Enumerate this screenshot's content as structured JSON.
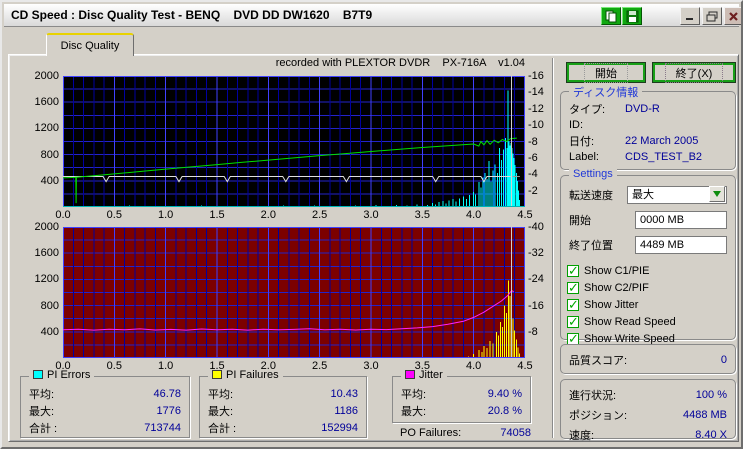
{
  "window": {
    "title": "CD Speed : Disc Quality Test - BENQ    DVD DD DW1620    B7T9"
  },
  "tab": {
    "label": "Disc Quality"
  },
  "chart_header": "recorded with PLEXTOR DVDR    PX-716A    v1.04",
  "chart_data": [
    {
      "type": "line+spikes",
      "title": "PI Errors / Read & Write Speed",
      "bg": "#000000",
      "border_bottom": "#00b6b6",
      "x_max": 4.5,
      "x_ticks": [
        "0.0",
        "0.5",
        "1.0",
        "1.5",
        "2.0",
        "2.5",
        "3.0",
        "3.5",
        "4.0",
        "4.5"
      ],
      "y_left": {
        "max": 2000,
        "ticks": [
          2000,
          1600,
          1200,
          800,
          400
        ]
      },
      "y_right": {
        "max": 16,
        "ticks": [
          16,
          14,
          12,
          10,
          8,
          6,
          4,
          2
        ]
      },
      "cursor_x": 4.37,
      "series": [
        {
          "name": "pi-errors",
          "type": "spikes",
          "color": "#00ffff",
          "points": [
            [
              0.05,
              14
            ],
            [
              0.15,
              8
            ],
            [
              0.25,
              18
            ],
            [
              0.35,
              6
            ],
            [
              0.45,
              16
            ],
            [
              0.55,
              9
            ],
            [
              0.65,
              20
            ],
            [
              0.75,
              7
            ],
            [
              0.85,
              14
            ],
            [
              0.95,
              10
            ],
            [
              1.05,
              18
            ],
            [
              1.15,
              8
            ],
            [
              1.25,
              15
            ],
            [
              1.35,
              22
            ],
            [
              1.45,
              9
            ],
            [
              1.55,
              16
            ],
            [
              1.65,
              7
            ],
            [
              1.75,
              19
            ],
            [
              1.85,
              11
            ],
            [
              1.95,
              15
            ],
            [
              2.05,
              8
            ],
            [
              2.15,
              20
            ],
            [
              2.25,
              10
            ],
            [
              2.35,
              16
            ],
            [
              2.45,
              24
            ],
            [
              2.55,
              12
            ],
            [
              2.65,
              18
            ],
            [
              2.75,
              9
            ],
            [
              2.85,
              22
            ],
            [
              2.95,
              14
            ],
            [
              3.05,
              28
            ],
            [
              3.15,
              18
            ],
            [
              3.25,
              32
            ],
            [
              3.35,
              22
            ],
            [
              3.45,
              38
            ],
            [
              3.55,
              30
            ],
            [
              3.6,
              60
            ],
            [
              3.63,
              40
            ],
            [
              3.66,
              75
            ],
            [
              3.7,
              90
            ],
            [
              3.73,
              55
            ],
            [
              3.76,
              100
            ],
            [
              3.8,
              120
            ],
            [
              3.83,
              85
            ],
            [
              3.86,
              130
            ],
            [
              3.9,
              160
            ],
            [
              3.93,
              120
            ],
            [
              3.96,
              180
            ],
            [
              4.0,
              230
            ],
            [
              4.02,
              190
            ],
            [
              4.05,
              380
            ],
            [
              4.07,
              300
            ],
            [
              4.09,
              450
            ],
            [
              4.11,
              520
            ],
            [
              4.13,
              430
            ],
            [
              4.15,
              700
            ],
            [
              4.17,
              390
            ],
            [
              4.19,
              560
            ],
            [
              4.21,
              650
            ],
            [
              4.23,
              520
            ],
            [
              4.25,
              900
            ],
            [
              4.27,
              720
            ],
            [
              4.29,
              880
            ],
            [
              4.31,
              1050
            ],
            [
              4.325,
              900
            ],
            [
              4.335,
              1776
            ],
            [
              4.345,
              1000
            ],
            [
              4.355,
              940
            ],
            [
              4.365,
              980
            ],
            [
              4.375,
              900
            ],
            [
              4.385,
              820
            ],
            [
              4.395,
              750
            ],
            [
              4.405,
              640
            ],
            [
              4.415,
              520
            ],
            [
              4.425,
              400
            ],
            [
              4.435,
              250
            ],
            [
              4.445,
              110
            ]
          ]
        },
        {
          "name": "write-speed",
          "type": "line",
          "color": "#dedede",
          "points": [
            [
              0,
              465
            ],
            [
              0.39,
              465
            ],
            [
              0.42,
              388
            ],
            [
              0.45,
              465
            ],
            [
              1.1,
              465
            ],
            [
              1.13,
              388
            ],
            [
              1.16,
              465
            ],
            [
              1.57,
              465
            ],
            [
              1.6,
              388
            ],
            [
              1.63,
              465
            ],
            [
              2.14,
              465
            ],
            [
              2.17,
              388
            ],
            [
              2.2,
              465
            ],
            [
              2.73,
              465
            ],
            [
              2.76,
              388
            ],
            [
              2.79,
              465
            ],
            [
              3.6,
              465
            ],
            [
              3.63,
              388
            ],
            [
              3.66,
              465
            ],
            [
              4.07,
              465
            ],
            [
              4.1,
              388
            ],
            [
              4.13,
              465
            ],
            [
              4.36,
              465
            ]
          ]
        },
        {
          "name": "write-speed-tail",
          "type": "line",
          "color": "#9a9a9a",
          "points": [
            [
              4.38,
              465
            ],
            [
              4.45,
              465
            ]
          ]
        },
        {
          "name": "read-speed",
          "type": "line",
          "color": "#00e000",
          "points": [
            [
              0,
              445
            ],
            [
              0.11,
              452
            ],
            [
              0.125,
              455
            ],
            [
              0.128,
              60
            ],
            [
              0.131,
              455
            ],
            [
              0.3,
              478
            ],
            [
              0.5,
              505
            ],
            [
              0.75,
              542
            ],
            [
              1.0,
              578
            ],
            [
              1.25,
              612
            ],
            [
              1.5,
              648
            ],
            [
              1.75,
              682
            ],
            [
              2.0,
              716
            ],
            [
              2.25,
              750
            ],
            [
              2.5,
              784
            ],
            [
              2.75,
              816
            ],
            [
              3.0,
              848
            ],
            [
              3.25,
              878
            ],
            [
              3.5,
              908
            ],
            [
              3.75,
              936
            ],
            [
              4.0,
              962
            ],
            [
              4.05,
              930
            ],
            [
              4.07,
              1000
            ],
            [
              4.1,
              950
            ],
            [
              4.13,
              1012
            ],
            [
              4.16,
              958
            ],
            [
              4.2,
              1018
            ],
            [
              4.24,
              980
            ],
            [
              4.28,
              1030
            ],
            [
              4.32,
              1000
            ],
            [
              4.36,
              1045
            ],
            [
              4.42,
              1052
            ]
          ]
        }
      ]
    },
    {
      "type": "line+spikes",
      "title": "PI Failures / Jitter",
      "bg": "#7c0000",
      "border_bottom": "#4040ff",
      "x_max": 4.5,
      "x_ticks": [
        "0.0",
        "0.5",
        "1.0",
        "1.5",
        "2.0",
        "2.5",
        "3.0",
        "3.5",
        "4.0",
        "4.5"
      ],
      "y_left": {
        "max": 2000,
        "ticks": [
          2000,
          1600,
          1200,
          800,
          400
        ]
      },
      "y_right": {
        "max": 40,
        "ticks": [
          40,
          32,
          24,
          16,
          8
        ]
      },
      "cursor_x": 4.37,
      "series": [
        {
          "name": "pi-failures",
          "type": "spikes",
          "color": "#ffff00",
          "points": [
            [
              0.3,
              10
            ],
            [
              0.75,
              8
            ],
            [
              1.2,
              12
            ],
            [
              1.65,
              8
            ],
            [
              2.1,
              10
            ],
            [
              2.55,
              8
            ],
            [
              3.0,
              12
            ],
            [
              3.4,
              8
            ],
            [
              3.7,
              14
            ],
            [
              3.85,
              10
            ],
            [
              3.95,
              25
            ],
            [
              4.0,
              60
            ],
            [
              4.05,
              120
            ],
            [
              4.08,
              90
            ],
            [
              4.1,
              180
            ],
            [
              4.13,
              150
            ],
            [
              4.16,
              260
            ],
            [
              4.19,
              220
            ],
            [
              4.22,
              400
            ],
            [
              4.24,
              340
            ],
            [
              4.26,
              550
            ],
            [
              4.28,
              470
            ],
            [
              4.3,
              800
            ],
            [
              4.32,
              690
            ],
            [
              4.34,
              1186
            ],
            [
              4.355,
              950
            ],
            [
              4.37,
              820
            ],
            [
              4.385,
              600
            ],
            [
              4.4,
              420
            ],
            [
              4.415,
              280
            ],
            [
              4.43,
              160
            ],
            [
              4.445,
              70
            ]
          ]
        },
        {
          "name": "read-marks",
          "type": "spikes",
          "color": "#00c000",
          "points": [
            [
              0.05,
              8
            ],
            [
              0.09,
              8
            ],
            [
              0.32,
              7
            ],
            [
              1.12,
              9
            ],
            [
              1.17,
              7
            ],
            [
              2.08,
              8
            ],
            [
              2.46,
              7
            ],
            [
              3.02,
              8
            ],
            [
              3.55,
              7
            ],
            [
              3.92,
              7
            ]
          ]
        },
        {
          "name": "jitter",
          "type": "line",
          "color": "#ff22ff",
          "points": [
            [
              0,
              432
            ],
            [
              0.15,
              438
            ],
            [
              0.3,
              426
            ],
            [
              0.45,
              440
            ],
            [
              0.6,
              430
            ],
            [
              0.75,
              444
            ],
            [
              0.9,
              428
            ],
            [
              1.05,
              436
            ],
            [
              1.2,
              426
            ],
            [
              1.35,
              442
            ],
            [
              1.5,
              430
            ],
            [
              1.65,
              438
            ],
            [
              1.8,
              426
            ],
            [
              1.95,
              440
            ],
            [
              2.1,
              430
            ],
            [
              2.25,
              436
            ],
            [
              2.4,
              446
            ],
            [
              2.55,
              430
            ],
            [
              2.7,
              438
            ],
            [
              2.85,
              428
            ],
            [
              3.0,
              440
            ],
            [
              3.15,
              434
            ],
            [
              3.3,
              448
            ],
            [
              3.45,
              460
            ],
            [
              3.6,
              480
            ],
            [
              3.75,
              515
            ],
            [
              3.9,
              560
            ],
            [
              4.0,
              620
            ],
            [
              4.1,
              700
            ],
            [
              4.2,
              800
            ],
            [
              4.27,
              870
            ],
            [
              4.33,
              950
            ],
            [
              4.37,
              1030
            ],
            [
              4.39,
              1010
            ]
          ]
        }
      ]
    }
  ],
  "stats": {
    "pi_errors": {
      "title": "PI Errors",
      "swatch": "#00ffff",
      "rows": [
        [
          "平均:",
          "46.78"
        ],
        [
          "最大:",
          "1776"
        ],
        [
          "合計 :",
          "713744"
        ]
      ]
    },
    "pi_failures": {
      "title": "PI Failures",
      "swatch": "#ffff00",
      "rows": [
        [
          "平均:",
          "10.43"
        ],
        [
          "最大:",
          "1186"
        ],
        [
          "合計 :",
          "152994"
        ]
      ]
    },
    "jitter": {
      "title": "Jitter",
      "swatch": "#ff00ff",
      "rows": [
        [
          "平均:",
          "9.40 %"
        ],
        [
          "最大:",
          "20.8 %"
        ]
      ]
    },
    "po_failures": {
      "label": "PO Failures:",
      "value": "74058"
    }
  },
  "sidebar": {
    "start_button": "開始",
    "exit_button": "終了(X)",
    "disc_info": {
      "title": "ディスク情報",
      "rows": [
        [
          "タイプ:",
          "DVD-R"
        ],
        [
          "ID:",
          ""
        ],
        [
          "日付:",
          "22 March 2005"
        ],
        [
          "Label:",
          "CDS_TEST_B2"
        ]
      ]
    },
    "settings": {
      "title": "Settings",
      "speed_label": "転送速度",
      "speed_value": "最大",
      "start_label": "開始",
      "start_value": "0000 MB",
      "end_label": "終了位置",
      "end_value": "4489 MB",
      "checkboxes": [
        "Show C1/PIE",
        "Show C2/PIF",
        "Show Jitter",
        "Show Read Speed",
        "Show Write Speed"
      ]
    },
    "score": {
      "label": "品質スコア:",
      "value": "0"
    },
    "progress": {
      "rows": [
        [
          "進行状況:",
          "100 %"
        ],
        [
          "ポジション:",
          "4488 MB"
        ],
        [
          "速度:",
          "8.40 X"
        ]
      ]
    }
  },
  "colors": {
    "accent_green": "#11a811",
    "value_navy": "#000099",
    "group_title_blue": "#2038d8",
    "tab_highlight": "#e8d200"
  }
}
